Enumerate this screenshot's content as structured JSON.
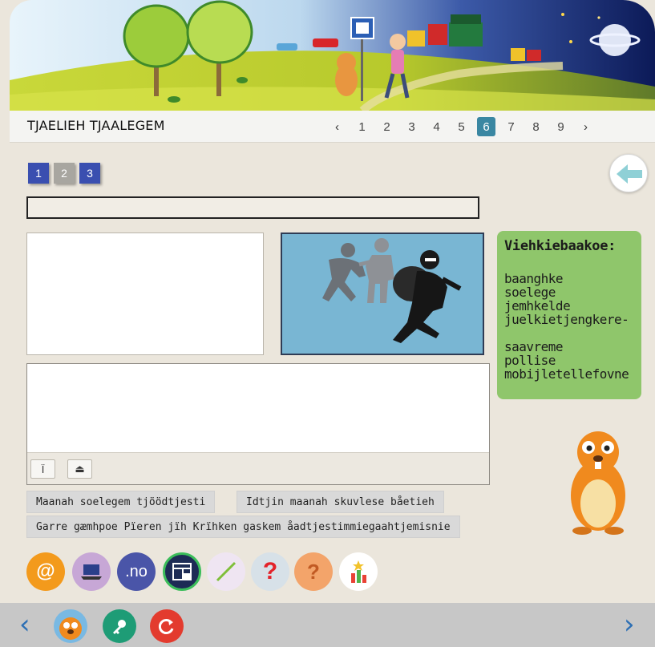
{
  "title": "TJAELIEH TJAALEGEM",
  "pager": {
    "prev": "‹",
    "next": "›",
    "pages": [
      "1",
      "2",
      "3",
      "4",
      "5",
      "6",
      "7",
      "8",
      "9"
    ],
    "active_page": "6"
  },
  "tasks": [
    "1",
    "2",
    "3"
  ],
  "word_panel": {
    "title": "Viehkiebaakoe:",
    "words": [
      "baanghke",
      "soelege",
      "jemhkelde",
      "juelkietjengkere-",
      "saavreme",
      "pollise",
      "mobijletellefovne"
    ]
  },
  "editor": {
    "tool1": "Ï",
    "tool2": "⏏"
  },
  "buttons": {
    "btn1": "Maanah soelegem tjöödtjesti",
    "btn2": "Idtjin maanah skuvlese båetieh",
    "btn3": "Garre gæmhpoe Pïeren jïh Krïhken gaskem åadtjestimmiegaahtjemisnie"
  },
  "circle_icons": {
    "email": "@",
    "laptop": "laptop-icon",
    "no": ".no",
    "layout": "layout-icon",
    "pencil": "pencil-icon",
    "question": "?",
    "help": "?",
    "chart": "chart-icon"
  },
  "colors": {
    "background": "#ebe6dc",
    "active_page": "#3a87a2",
    "tab_blue": "#3a4fb0",
    "word_panel": "#8fc66b",
    "nav_blue": "#2d6fb4"
  },
  "bottom": {
    "prev": "‹",
    "next": "›"
  }
}
